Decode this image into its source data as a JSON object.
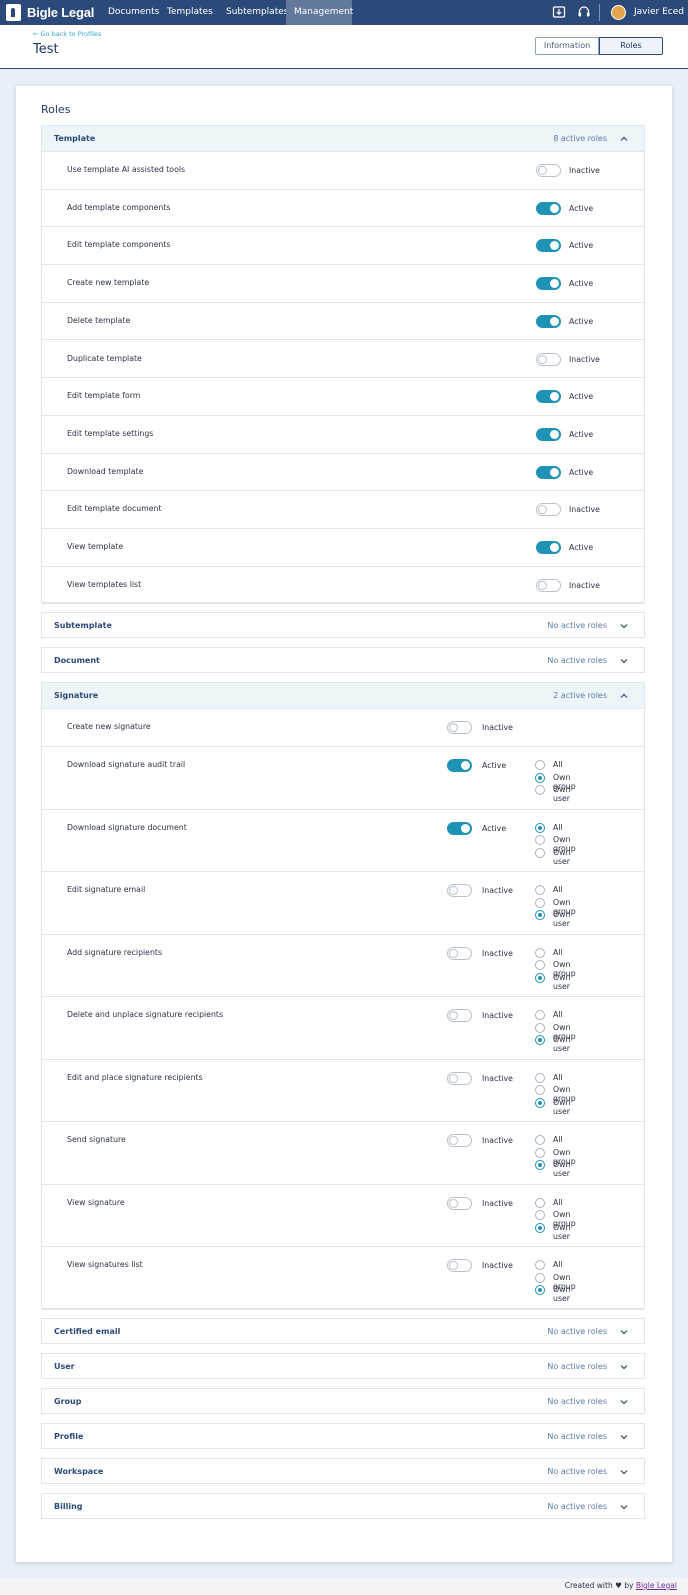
{
  "nav": {
    "brand": "Bigle Legal",
    "items": [
      {
        "label": "Documents",
        "active": false
      },
      {
        "label": "Templates",
        "active": false
      },
      {
        "label": "Subtemplates",
        "active": false
      },
      {
        "label": "Management",
        "active": true
      }
    ],
    "icons": [
      "download-icon",
      "headset-icon"
    ],
    "user_name": "Javier Eced"
  },
  "subheader": {
    "back_link": "Go back to Profiles",
    "title": "Test",
    "tabs": [
      {
        "label": "Information",
        "active": false
      },
      {
        "label": "Roles",
        "active": true
      }
    ]
  },
  "roles": {
    "title": "Roles",
    "sections": [
      {
        "name": "Template",
        "count": "8 active roles",
        "expanded": true,
        "rows": [
          {
            "label": "Use template AI assisted tools",
            "active": false,
            "state": "Inactive"
          },
          {
            "label": "Add template components",
            "active": true,
            "state": "Active"
          },
          {
            "label": "Edit template components",
            "active": true,
            "state": "Active"
          },
          {
            "label": "Create new template",
            "active": true,
            "state": "Active"
          },
          {
            "label": "Delete template",
            "active": true,
            "state": "Active"
          },
          {
            "label": "Duplicate template",
            "active": false,
            "state": "Inactive"
          },
          {
            "label": "Edit template form",
            "active": true,
            "state": "Active"
          },
          {
            "label": "Edit template settings",
            "active": true,
            "state": "Active"
          },
          {
            "label": "Download template",
            "active": true,
            "state": "Active"
          },
          {
            "label": "Edit template document",
            "active": false,
            "state": "Inactive"
          },
          {
            "label": "View template",
            "active": true,
            "state": "Active"
          },
          {
            "label": "View templates list",
            "active": false,
            "state": "Inactive"
          }
        ]
      },
      {
        "name": "Subtemplate",
        "count": "No active roles",
        "expanded": false
      },
      {
        "name": "Document",
        "count": "No active roles",
        "expanded": false
      },
      {
        "name": "Signature",
        "count": "2 active roles",
        "expanded": true,
        "scope_options": [
          "All",
          "Own group",
          "Own user"
        ],
        "rows": [
          {
            "label": "Create new signature",
            "active": false,
            "state": "Inactive",
            "scope": null
          },
          {
            "label": "Download signature audit trail",
            "active": true,
            "state": "Active",
            "scope": "Own group"
          },
          {
            "label": "Download signature document",
            "active": true,
            "state": "Active",
            "scope": "All"
          },
          {
            "label": "Edit signature email",
            "active": false,
            "state": "Inactive",
            "scope": "Own user"
          },
          {
            "label": "Add signature recipients",
            "active": false,
            "state": "Inactive",
            "scope": "Own user"
          },
          {
            "label": "Delete and unplace signature recipients",
            "active": false,
            "state": "Inactive",
            "scope": "Own user"
          },
          {
            "label": "Edit and place signature recipients",
            "active": false,
            "state": "Inactive",
            "scope": "Own user"
          },
          {
            "label": "Send signature",
            "active": false,
            "state": "Inactive",
            "scope": "Own user"
          },
          {
            "label": "View signature",
            "active": false,
            "state": "Inactive",
            "scope": "Own user"
          },
          {
            "label": "View signatures list",
            "active": false,
            "state": "Inactive",
            "scope": "Own user"
          }
        ]
      },
      {
        "name": "Certified email",
        "count": "No active roles",
        "expanded": false
      },
      {
        "name": "User",
        "count": "No active roles",
        "expanded": false
      },
      {
        "name": "Group",
        "count": "No active roles",
        "expanded": false
      },
      {
        "name": "Profile",
        "count": "No active roles",
        "expanded": false
      },
      {
        "name": "Workspace",
        "count": "No active roles",
        "expanded": false
      },
      {
        "name": "Billing",
        "count": "No active roles",
        "expanded": false
      }
    ]
  },
  "footer": {
    "prefix": "Created with",
    "middle": "by",
    "link": "Bigle Legal"
  },
  "colors": {
    "nav_bg": "#2c4a79",
    "accent": "#1f93b5",
    "section_header_open": "#eef5f9"
  }
}
